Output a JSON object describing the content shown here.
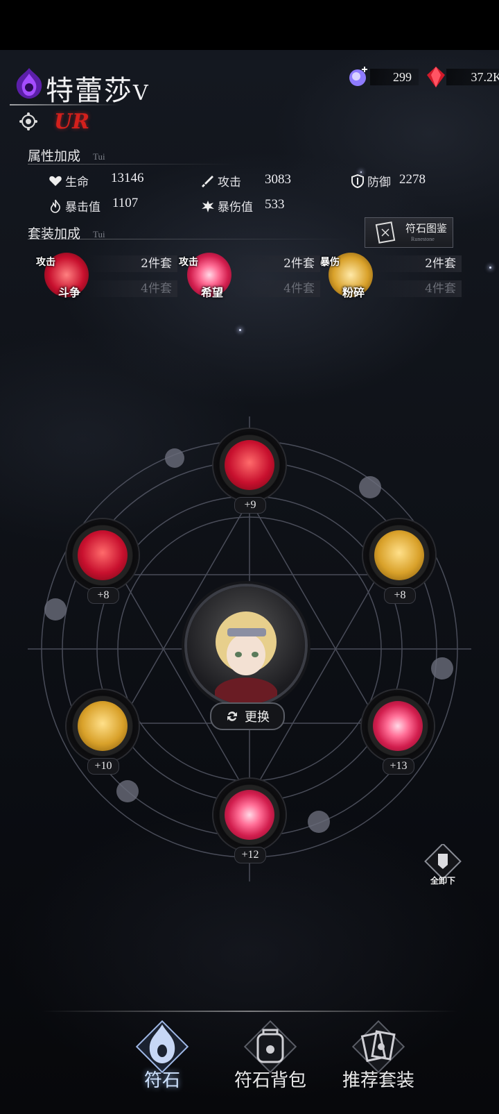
{
  "hero": {
    "name": "特蕾莎",
    "name_suffix": "V",
    "rarity": "UR"
  },
  "resources": [
    {
      "icon": "crystal-icon",
      "value": "299"
    },
    {
      "icon": "red-gem-icon",
      "value": "37.2K"
    }
  ],
  "attributes": {
    "title": "属性加成",
    "subtitle": "Tui",
    "stats": [
      {
        "icon": "heart-icon",
        "label": "生命",
        "value": "13146"
      },
      {
        "icon": "sword-icon",
        "label": "攻击",
        "value": "3083"
      },
      {
        "icon": "shield-icon",
        "label": "防御",
        "value": "2278"
      },
      {
        "icon": "flame-icon",
        "label": "暴击值",
        "value": "1107"
      },
      {
        "icon": "burst-icon",
        "label": "暴伤值",
        "value": "533"
      }
    ]
  },
  "sets": {
    "title": "套装加成",
    "subtitle": "Tui",
    "atlas_label": "符石图鉴",
    "atlas_sub": "Runestone",
    "items": [
      {
        "tag": "攻击",
        "name": "斗争",
        "two": "2件套",
        "four": "4件套",
        "color": "#c8102e"
      },
      {
        "tag": "攻击",
        "name": "希望",
        "two": "2件套",
        "four": "4件套",
        "color": "#d21e4e"
      },
      {
        "tag": "暴伤",
        "name": "粉碎",
        "two": "2件套",
        "four": "4件套",
        "color": "#d9a12a"
      }
    ]
  },
  "slots": [
    {
      "level": "+9",
      "type": "red"
    },
    {
      "level": "+8",
      "type": "red"
    },
    {
      "level": "+8",
      "type": "gold"
    },
    {
      "level": "+10",
      "type": "gold"
    },
    {
      "level": "+13",
      "type": "pink"
    },
    {
      "level": "+12",
      "type": "pink"
    }
  ],
  "swap_label": "更换",
  "unequip_label": "全卸下",
  "nav": [
    {
      "label": "符石",
      "active": true
    },
    {
      "label": "符石背包",
      "active": false
    },
    {
      "label": "推荐套装",
      "active": false
    }
  ]
}
